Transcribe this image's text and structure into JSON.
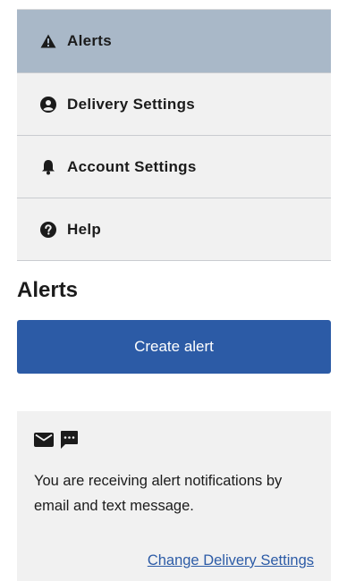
{
  "nav": {
    "items": [
      {
        "label": "Alerts",
        "icon": "warning-icon",
        "active": true
      },
      {
        "label": "Delivery Settings",
        "icon": "user-circle-icon",
        "active": false
      },
      {
        "label": "Account Settings",
        "icon": "bell-icon",
        "active": false
      },
      {
        "label": "Help",
        "icon": "help-circle-icon",
        "active": false
      }
    ]
  },
  "page": {
    "title": "Alerts"
  },
  "actions": {
    "create_label": "Create alert"
  },
  "notice": {
    "icons": [
      "mail-icon",
      "chat-icon"
    ],
    "text": "You are receiving alert notifications by email and text message.",
    "link_label": "Change Delivery Settings"
  },
  "colors": {
    "nav_active_bg": "#a9b8c8",
    "nav_bg": "#f1f1f1",
    "primary": "#2c5ba6",
    "text": "#1b1b1b"
  }
}
